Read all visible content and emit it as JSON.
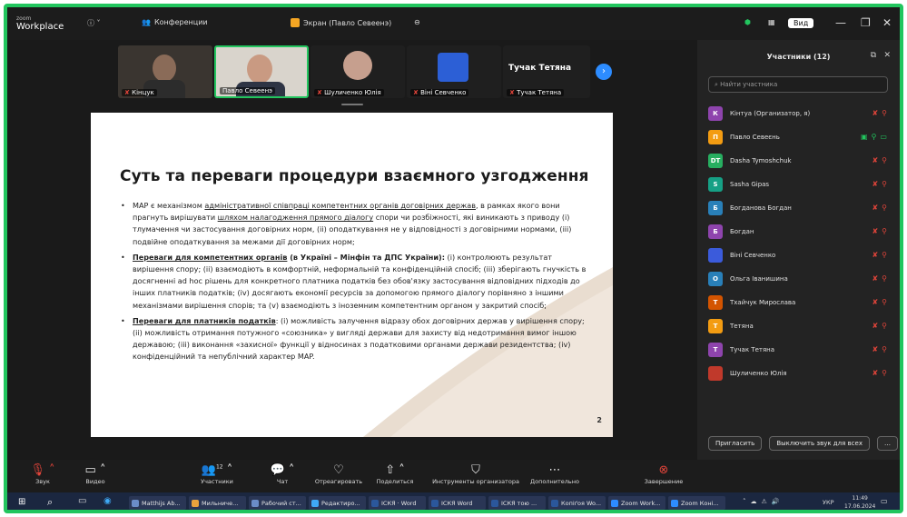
{
  "titlebar": {
    "logo_top": "zoom",
    "logo_bottom": "Workplace",
    "tab_conferences": "Конференции",
    "tab_screen": "Экран (Павло Севеенэ)",
    "view_label": "Вид",
    "accent_color": "#f5a623"
  },
  "thumbnails": [
    {
      "label": "Кінцук"
    },
    {
      "label": "Павло Севеенэ"
    },
    {
      "label": "Шуличенко Юлія"
    },
    {
      "label": "Віні Севченко"
    },
    {
      "label": "Тучак Тетяна",
      "name_card": "Тучак Тетяна"
    }
  ],
  "slide": {
    "title": "Суть та переваги процедури взаємного узгодження",
    "page_number": "2",
    "bullet1_a": "MAP є механізмом ",
    "bullet1_u": "адміністративної співпраці компетентних органів договірних держав",
    "bullet1_b": ", в рамках якого вони прагнуть вирішувати ",
    "bullet1_u2": "шляхом налагодження прямого діалогу",
    "bullet1_c": " спори чи розбіжності, які виникають з приводу (і) тлумачення чи застосування договірних норм, (іі) оподаткування не у відповідності з договірними нормами, (ііі) подвійне оподаткування за межами дії договірних норм;",
    "bullet2_u": "Переваги для компетентних органів",
    "bullet2_bold": " (в Україні – Мінфін та ДПС України):",
    "bullet2_text": " (і) контролюють результат вирішення спору; (іі) взаємодіють в комфортній, неформальній та конфіденційній спосіб; (ііі) зберігають гнучкість в досягненні ad hoc рішень для конкретного платника податків без обов'язку застосування відповідних підходів до інших платників податків; (іv) досягають економії ресурсів за допомогою прямого діалогу порівняно з іншими механізмами вирішення спорів; та (v) взаємодіють з іноземним компетентним органом у закритий спосіб;",
    "bullet3_u": "Переваги для платників податків",
    "bullet3_text": ": (і) можливість залучення відразу обох договірних держав у вирішення спору; (іі) можливість отримання потужного «союзника» у вигляді держави для захисту від недотримання вимог іншою державою; (ііі) виконання «захисної» функції у відносинах з податковими органами держави резидентства; (іv) конфіденційний та непублічний характер MAP."
  },
  "sidebar": {
    "title": "Участники (12)",
    "search_placeholder": "Найти участника",
    "participants": [
      {
        "initial": "К",
        "name": "Кінтуа (Организатор, я)",
        "color": "#8e44ad"
      },
      {
        "initial": "П",
        "name": "Павло Севеєнь",
        "color": "#f39c12"
      },
      {
        "initial": "DT",
        "name": "Dasha Tymoshchuk",
        "color": "#27ae60"
      },
      {
        "initial": "S",
        "name": "Sasha Gipas",
        "color": "#16a085"
      },
      {
        "initial": "Б",
        "name": "Богданова Богдан",
        "color": "#2980b9"
      },
      {
        "initial": "Б",
        "name": "Богдан",
        "color": "#8e44ad"
      },
      {
        "initial": "",
        "name": "Віні Севченко",
        "color": "#3b5bdb"
      },
      {
        "initial": "О",
        "name": "Ольга Іванишина",
        "color": "#2980b9"
      },
      {
        "initial": "Т",
        "name": "Тхайчук Мирослава",
        "color": "#d35400"
      },
      {
        "initial": "Т",
        "name": "Тетяна",
        "color": "#f39c12"
      },
      {
        "initial": "Т",
        "name": "Тучак Тетяна",
        "color": "#8e44ad"
      },
      {
        "initial": "",
        "name": "Шуличенко Юлія",
        "color": "#c0392b"
      }
    ],
    "invite_label": "Пригласить",
    "mute_all_label": "Выключить звук для всех"
  },
  "toolbar": {
    "audio": "Звук",
    "video": "Видео",
    "participants": "Участники",
    "participants_count": "12",
    "chat": "Чат",
    "react": "Отреагировать",
    "share": "Поделиться",
    "host_tools": "Инструменты организатора",
    "more": "Дополнительно",
    "end": "Завершение"
  },
  "taskbar": {
    "items": [
      "Matthijs Ab...",
      "Мильниче...",
      "Рабочий ст...",
      "Редактиро...",
      "ІСКЯ · Word",
      "ІСКЯ Word",
      "ІСКЯ тою ...",
      "Копіґоя Wo...",
      "Zoom Work...",
      "Zoom Коні..."
    ],
    "lang": "УКР",
    "time": "11:49",
    "date": "17.06.2024"
  }
}
